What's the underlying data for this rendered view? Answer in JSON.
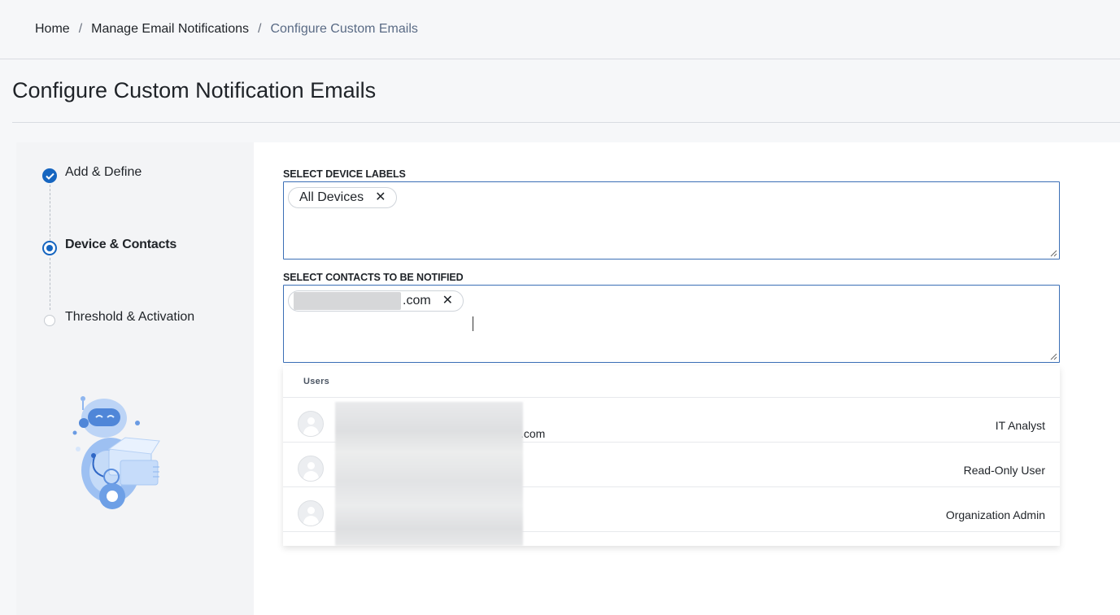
{
  "breadcrumb": {
    "items": [
      "Home",
      "Manage Email Notifications",
      "Configure Custom Emails"
    ],
    "separator": "/"
  },
  "page": {
    "title": "Configure Custom Notification Emails"
  },
  "steps": [
    {
      "label": "Add & Define",
      "state": "done"
    },
    {
      "label": "Device & Contacts",
      "state": "current"
    },
    {
      "label": "Threshold & Activation",
      "state": "todo"
    }
  ],
  "device_labels": {
    "label": "SELECT DEVICE LABELS",
    "chips": [
      {
        "text": "All Devices",
        "remove": "✕"
      }
    ]
  },
  "contacts": {
    "label": "SELECT CONTACTS TO BE NOTIFIED",
    "chips": [
      {
        "text": ".com",
        "remove": "✕"
      }
    ]
  },
  "dropdown": {
    "section_header": "Users",
    "options": [
      {
        "email_suffix": ".com",
        "role": "IT Analyst"
      },
      {
        "email_suffix": "",
        "role": "Read-Only User"
      },
      {
        "email_suffix": "",
        "role": "Organization Admin"
      }
    ]
  },
  "colors": {
    "accent": "#1565c0",
    "field_border": "#3b6fb6",
    "panel_bg": "#f3f4f6"
  }
}
